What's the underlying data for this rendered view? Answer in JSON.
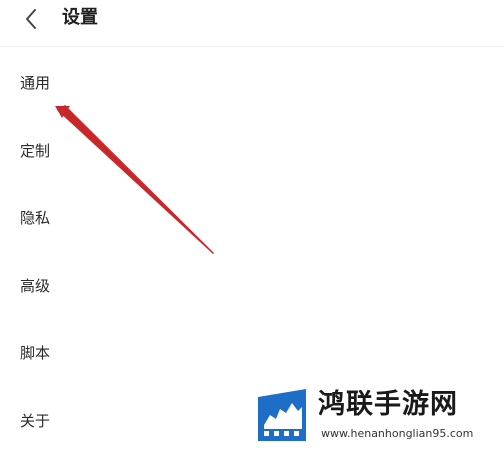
{
  "header": {
    "title": "设置",
    "back_icon": "chevron-left-icon"
  },
  "menu": {
    "items": [
      {
        "label": "通用"
      },
      {
        "label": "定制"
      },
      {
        "label": "隐私"
      },
      {
        "label": "高级"
      },
      {
        "label": "脚本"
      },
      {
        "label": "关于"
      }
    ]
  },
  "annotation": {
    "arrow_color": "#c8282a"
  },
  "watermark": {
    "name": "鸿联手游网",
    "url": "www.henanhonglian95.com",
    "logo_colors": [
      "#1e6ec8",
      "#ffffff"
    ]
  }
}
